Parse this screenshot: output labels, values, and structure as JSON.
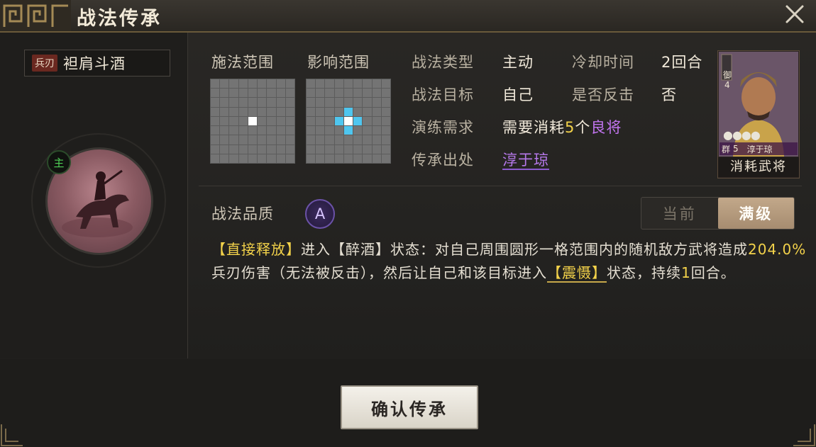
{
  "window": {
    "title": "战法传承"
  },
  "skill": {
    "tag": "兵刃",
    "name": "袒肩斗酒",
    "general_badge": "主"
  },
  "ranges": {
    "cast_label": "施法范围",
    "effect_label": "影响范围"
  },
  "info": {
    "type_label": "战法类型",
    "type_value": "主动",
    "cooldown_label": "冷却时间",
    "cooldown_value": "2回合",
    "target_label": "战法目标",
    "target_value": "自己",
    "counter_label": "是否反击",
    "counter_value": "否",
    "drill_label": "演练需求",
    "drill_prefix": "需要消耗",
    "drill_count": "5",
    "drill_mid": "个",
    "drill_quality": "良将",
    "source_label": "传承出处",
    "source_value": "淳于琼"
  },
  "card": {
    "type": "御",
    "cost": "4",
    "faction": "群",
    "level": "5",
    "name": "淳于琼",
    "caption": "消耗武将"
  },
  "quality": {
    "label": "战法品质",
    "grade": "A"
  },
  "level_toggle": {
    "current": "当前",
    "max": "满级",
    "active": "max"
  },
  "description": {
    "p1": "【直接释放】",
    "p2": "进入【醉酒】状态：对自己周围圆形一格范围内的随机敌方武将造成",
    "p3": "204.0%",
    "p4": "兵刃伤害（无法被反击），然后让自己和该目标进入",
    "p5": "【震慑】",
    "p6": "状态，持续",
    "p7": "1",
    "p8": "回合。"
  },
  "confirm_button": "确认传承",
  "colors": {
    "accent_gold": "#f3d24a",
    "accent_purple": "#c275f0",
    "badge_green": "#4fcf56"
  }
}
